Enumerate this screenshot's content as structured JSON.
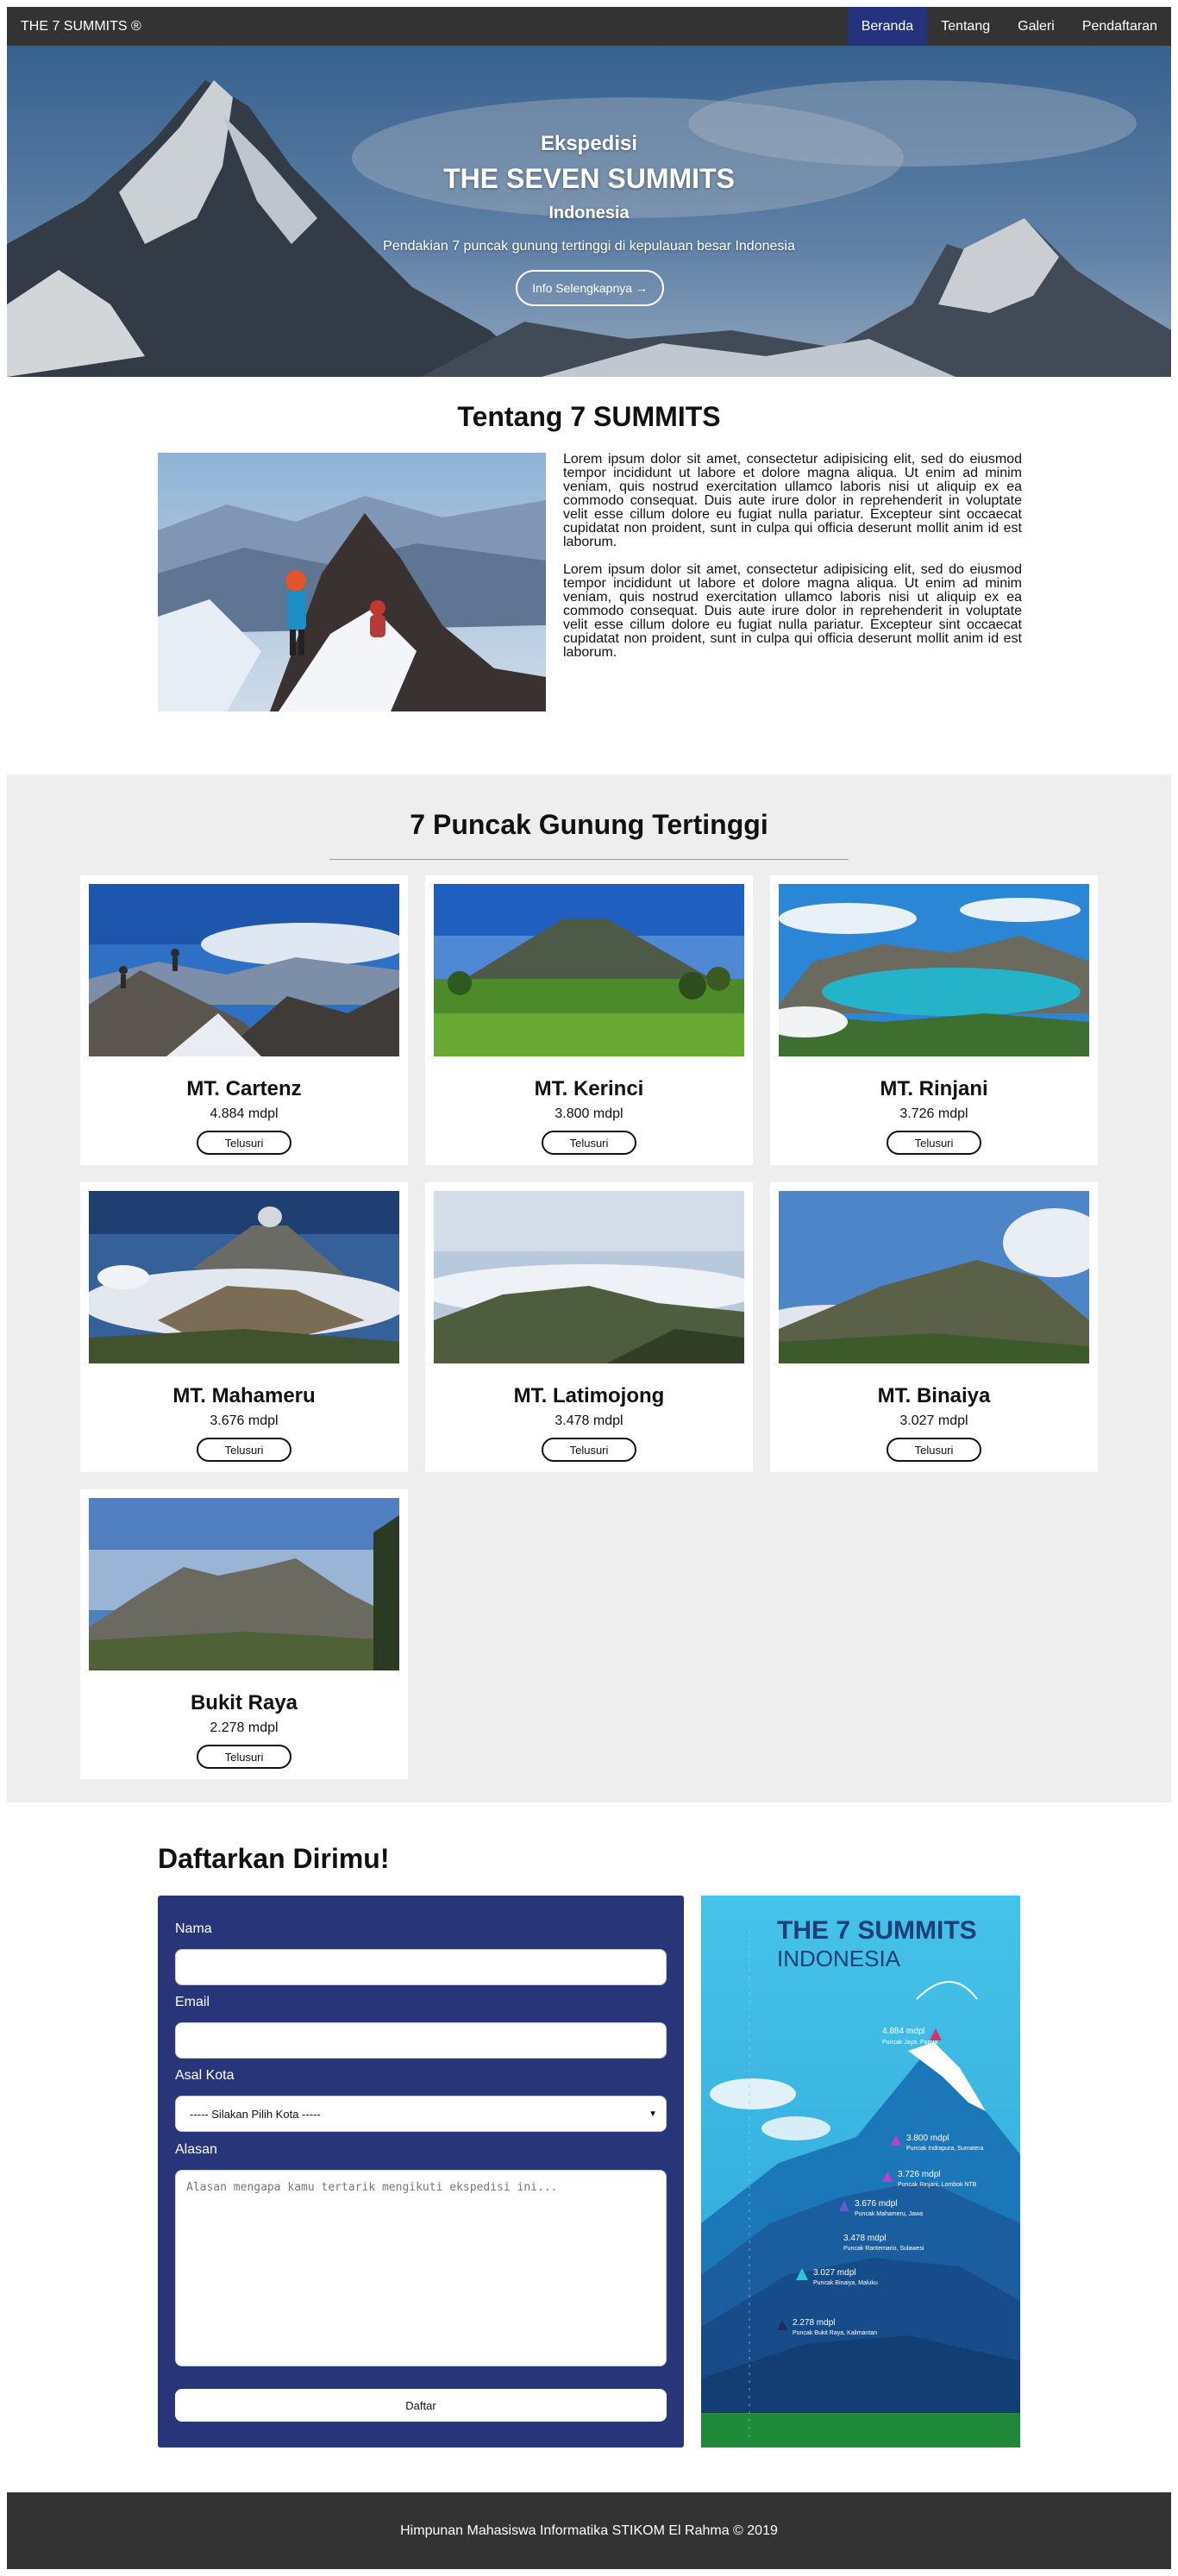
{
  "nav": {
    "brand": "THE 7 SUMMITS ®",
    "links": [
      {
        "label": "Beranda",
        "active": true
      },
      {
        "label": "Tentang",
        "active": false
      },
      {
        "label": "Galeri",
        "active": false
      },
      {
        "label": "Pendaftaran",
        "active": false
      }
    ]
  },
  "hero": {
    "kicker": "Ekspedisi",
    "title": "THE SEVEN SUMMITS",
    "subtitle": "Indonesia",
    "description": "Pendakian 7 puncak gunung tertinggi di kepulauan besar Indonesia",
    "button": "Info Selengkapnya →"
  },
  "about": {
    "title": "Tentang 7 SUMMITS",
    "paragraphs": [
      "Lorem ipsum dolor sit amet, consectetur adipisicing elit, sed do eiusmod tempor incididunt ut labore et dolore magna aliqua. Ut enim ad minim veniam, quis nostrud exercitation ullamco laboris nisi ut aliquip ex ea commodo consequat. Duis aute irure dolor in reprehenderit in voluptate velit esse cillum dolore eu fugiat nulla pariatur. Excepteur sint occaecat cupidatat non proident, sunt in culpa qui officia deserunt mollit anim id est laborum.",
      "Lorem ipsum dolor sit amet, consectetur adipisicing elit, sed do eiusmod tempor incididunt ut labore et dolore magna aliqua. Ut enim ad minim veniam, quis nostrud exercitation ullamco laboris nisi ut aliquip ex ea commodo consequat. Duis aute irure dolor in reprehenderit in voluptate velit esse cillum dolore eu fugiat nulla pariatur. Excepteur sint occaecat cupidatat non proident, sunt in culpa qui officia deserunt mollit anim id est laborum."
    ]
  },
  "summits": {
    "title": "7 Puncak Gunung Tertinggi",
    "button_label": "Telusuri",
    "items": [
      {
        "name": "MT. Cartenz",
        "height": "4.884 mdpl"
      },
      {
        "name": "MT. Kerinci",
        "height": "3.800 mdpl"
      },
      {
        "name": "MT. Rinjani",
        "height": "3.726 mdpl"
      },
      {
        "name": "MT. Mahameru",
        "height": "3.676 mdpl"
      },
      {
        "name": "MT. Latimojong",
        "height": "3.478 mdpl"
      },
      {
        "name": "MT. Binaiya",
        "height": "3.027 mdpl"
      },
      {
        "name": "Bukit Raya",
        "height": "2.278 mdpl"
      }
    ]
  },
  "register": {
    "title": "Daftarkan Dirimu!",
    "name_label": "Nama",
    "email_label": "Email",
    "city_label": "Asal Kota",
    "city_selected": "----- Silakan Pilih Kota -----",
    "reason_label": "Alasan",
    "reason_placeholder": "Alasan mengapa kamu tertarik mengikuti ekspedisi ini...",
    "submit_label": "Daftar"
  },
  "poster": {
    "title_line1": "THE 7 SUMMITS",
    "title_line2": "INDONESIA",
    "peaks": [
      {
        "height": "4.884 mdpl",
        "name": "Puncak Jaya, Papua"
      },
      {
        "height": "3.800 mdpl",
        "name": "Puncak Indrapura, Sumatera"
      },
      {
        "height": "3.726 mdpl",
        "name": "Puncak Rinjani, Lombok NTB"
      },
      {
        "height": "3.676 mdpl",
        "name": "Puncak Mahameru, Jawa"
      },
      {
        "height": "3.478 mdpl",
        "name": "Puncak Rantemario, Sulawesi"
      },
      {
        "height": "3.027 mdpl",
        "name": "Puncak Binaiya, Maluku"
      },
      {
        "height": "2.278 mdpl",
        "name": "Puncak Bukit Raya, Kalimantan"
      }
    ]
  },
  "footer": {
    "text": "Himpunan Mahasiswa Informatika STIKOM El Rahma © 2019"
  }
}
